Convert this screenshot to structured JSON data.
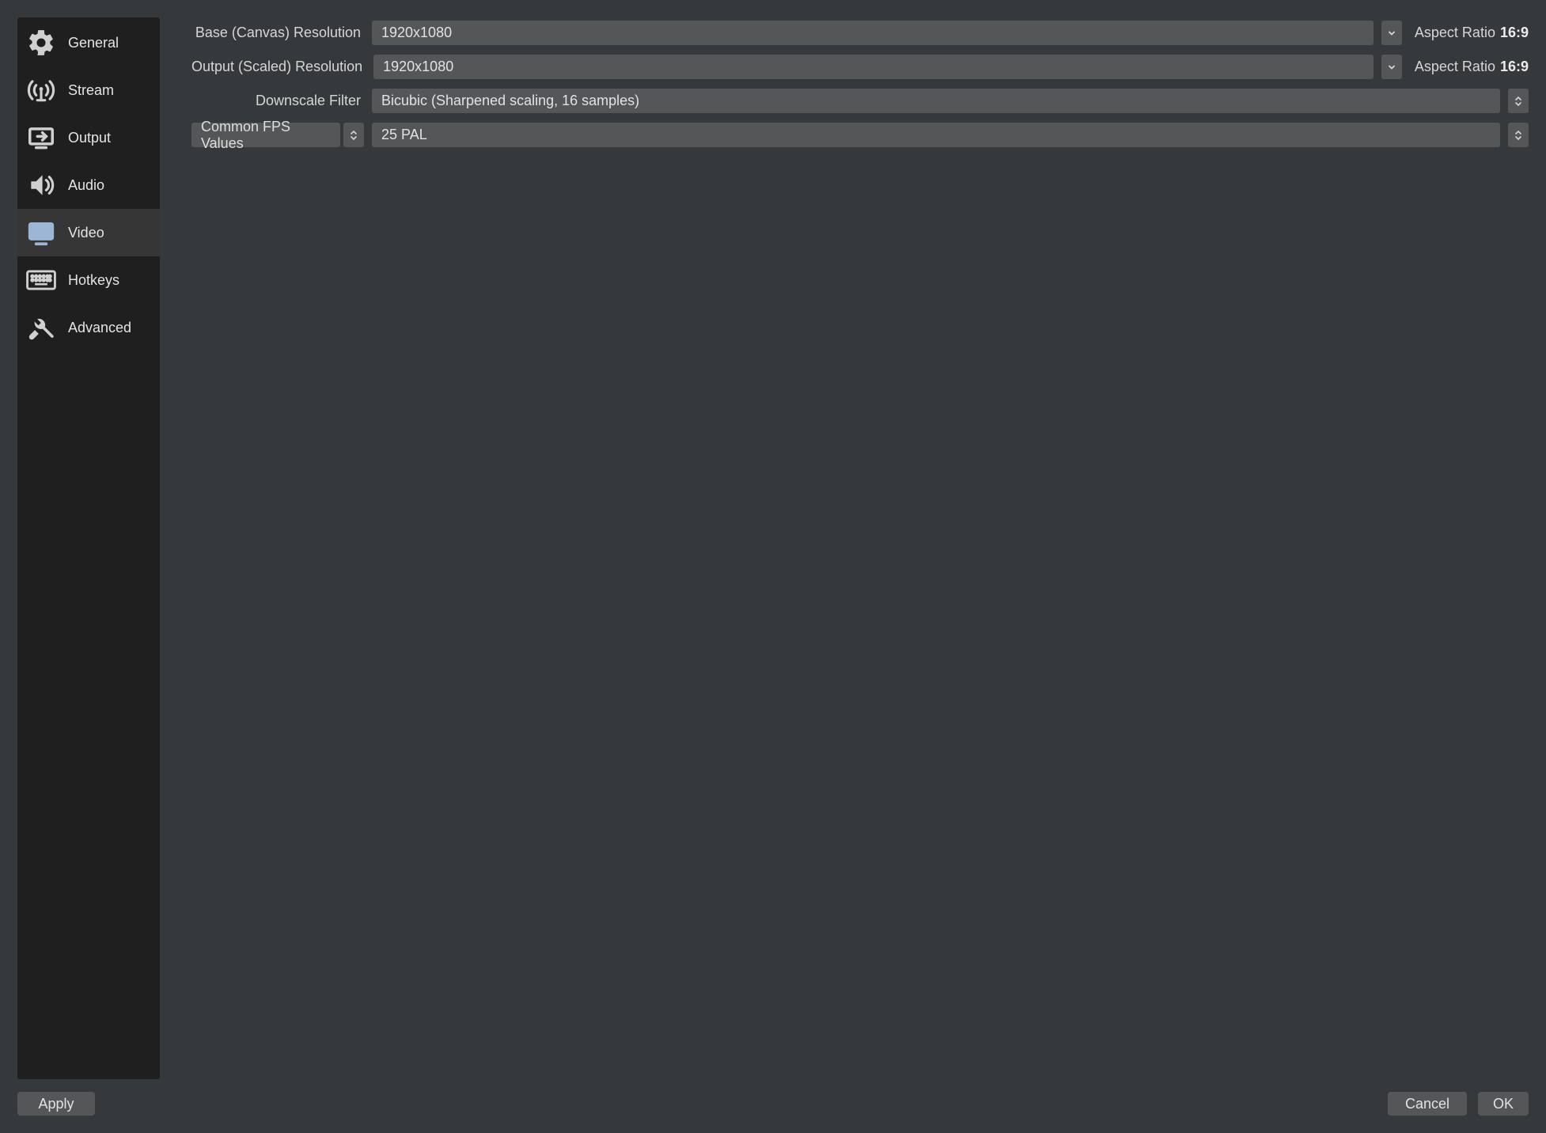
{
  "sidebar": {
    "items": [
      {
        "label": "General"
      },
      {
        "label": "Stream"
      },
      {
        "label": "Output"
      },
      {
        "label": "Audio"
      },
      {
        "label": "Video"
      },
      {
        "label": "Hotkeys"
      },
      {
        "label": "Advanced"
      }
    ],
    "active_index": 4
  },
  "settings": {
    "base_resolution": {
      "label": "Base (Canvas) Resolution",
      "value": "1920x1080",
      "aspect_label": "Aspect Ratio",
      "aspect_value": "16:9"
    },
    "output_resolution": {
      "label": "Output (Scaled) Resolution",
      "value": "1920x1080",
      "aspect_label": "Aspect Ratio",
      "aspect_value": "16:9"
    },
    "downscale_filter": {
      "label": "Downscale Filter",
      "value": "Bicubic (Sharpened scaling, 16 samples)"
    },
    "fps": {
      "mode_label": "Common FPS Values",
      "value": "25 PAL"
    }
  },
  "footer": {
    "apply": "Apply",
    "cancel": "Cancel",
    "ok": "OK"
  }
}
